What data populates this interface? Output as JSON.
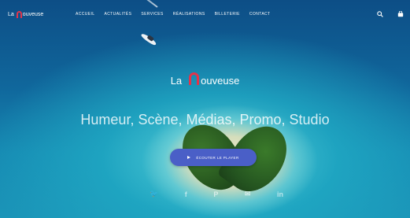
{
  "header": {
    "logo": {
      "prefix": "La",
      "rest": "ouveuse"
    },
    "nav": [
      "ACCUEIL",
      "ACTUALITÉS",
      "SERVICES",
      "RÉALISATIONS",
      "BILLETERIE",
      "CONTACT"
    ],
    "icons": [
      "search-icon",
      "cart-icon"
    ]
  },
  "hero": {
    "brand": {
      "prefix": "La",
      "rest": "ouveuse"
    },
    "tagline": "Humeur, Scène, Médias, Promo, Studio",
    "cta_label": "ÉCOUTER LE PLAYER",
    "social": [
      {
        "icon": "twitter-icon",
        "glyph": "🐦"
      },
      {
        "icon": "facebook-icon",
        "glyph": "f"
      },
      {
        "icon": "pinterest-icon",
        "glyph": "P"
      },
      {
        "icon": "email-icon",
        "glyph": "✉"
      },
      {
        "icon": "linkedin-icon",
        "glyph": "in"
      }
    ]
  },
  "colors": {
    "accent": "#e3344a",
    "button": "#4a5fc7"
  }
}
